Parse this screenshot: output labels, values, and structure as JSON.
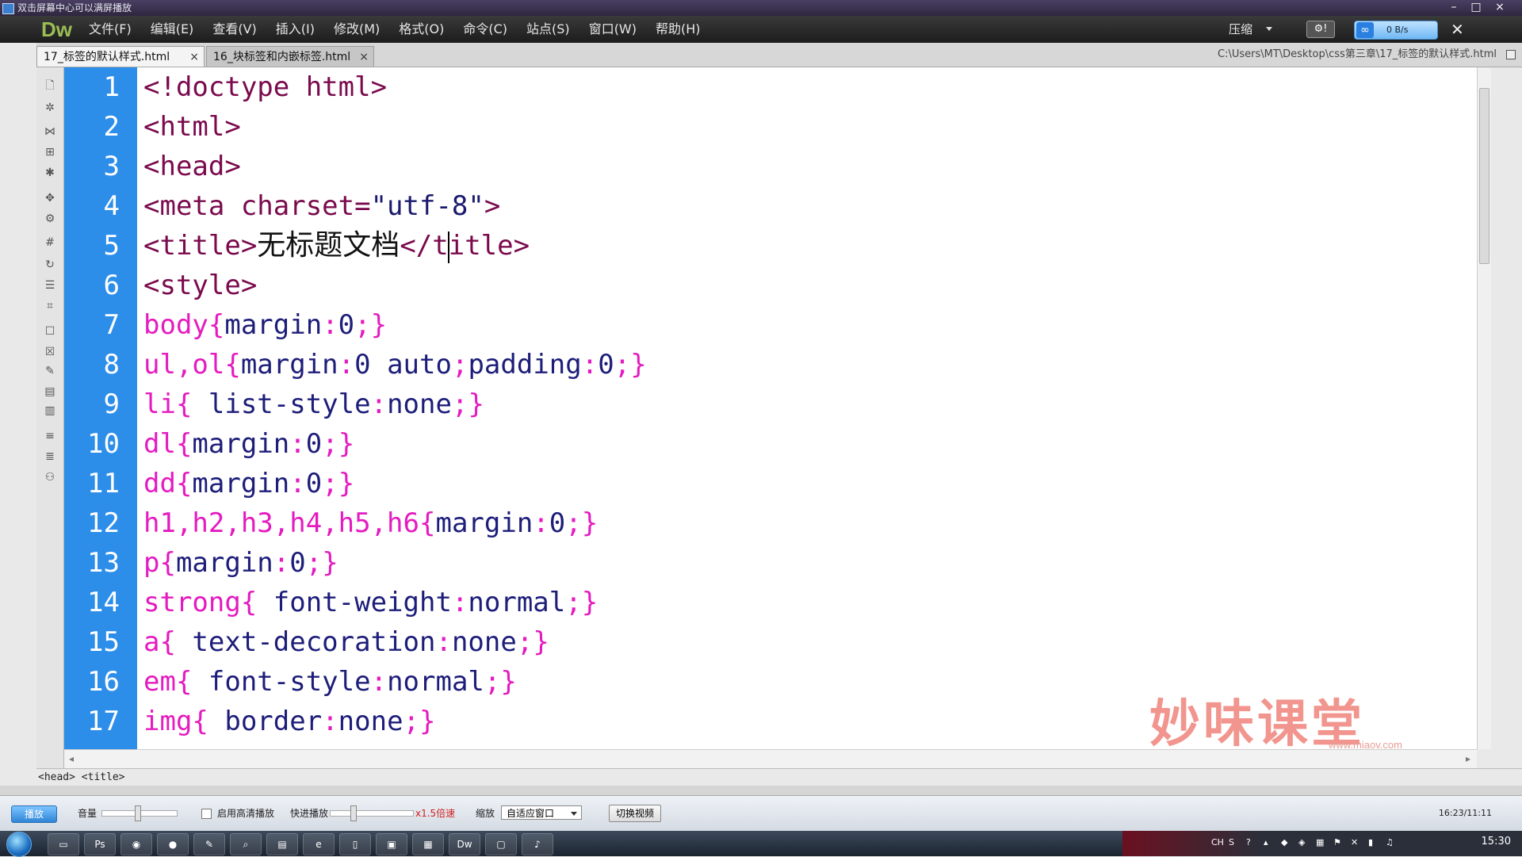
{
  "player": {
    "title": "双击屏幕中心可以满屏播放",
    "controls": {
      "play_label": "播放",
      "volume_label": "音量",
      "hd_label": "启用高清播放",
      "fast_label": "快进播放",
      "speed_label": "x1.5倍速",
      "zoom_label": "缩放",
      "zoom_value": "自适应窗口",
      "switch_label": "切换视频",
      "time": "16:23/11:11"
    }
  },
  "app": {
    "logo": "Dw",
    "menu": [
      "文件(F)",
      "编辑(E)",
      "查看(V)",
      "插入(I)",
      "修改(M)",
      "格式(O)",
      "命令(C)",
      "站点(S)",
      "窗口(W)",
      "帮助(H)"
    ],
    "compress_label": "压缩",
    "net_speed": "0 B/s"
  },
  "tabs": [
    {
      "label": "17_标签的默认样式.html",
      "active": true
    },
    {
      "label": "16_块标签和内嵌标签.html",
      "active": false
    }
  ],
  "file_path": "C:\\Users\\MT\\Desktop\\css第三章\\17_标签的默认样式.html",
  "code": {
    "line_numbers": [
      "1",
      "2",
      "3",
      "4",
      "5",
      "6",
      "7",
      "8",
      "9",
      "10",
      "11",
      "12",
      "13",
      "14",
      "15",
      "16",
      "17"
    ],
    "title_text": "无标题文档"
  },
  "tag_selector": "<head> <title>",
  "watermark": {
    "brand": "妙味课堂",
    "url": "www.miaov.com"
  },
  "taskbar": {
    "clock": "15:30",
    "ime": "CH"
  }
}
